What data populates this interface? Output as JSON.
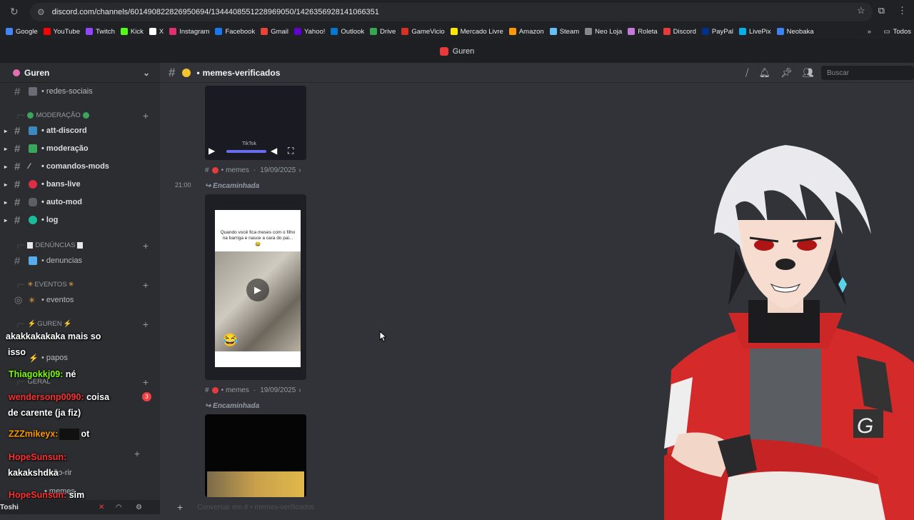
{
  "browser": {
    "url": "discord.com/channels/601490822826950694/1344408551228969050/1426356928141066351",
    "bookmarks": [
      {
        "label": "Google",
        "color": "#4285f4"
      },
      {
        "label": "YouTube",
        "color": "#ff0000"
      },
      {
        "label": "Twitch",
        "color": "#9146ff"
      },
      {
        "label": "Kick",
        "color": "#53fc18"
      },
      {
        "label": "X",
        "color": "#ffffff"
      },
      {
        "label": "Instagram",
        "color": "#e1306c"
      },
      {
        "label": "Facebook",
        "color": "#1877f2"
      },
      {
        "label": "Gmail",
        "color": "#ea4335"
      },
      {
        "label": "Yahoo!",
        "color": "#6001d2"
      },
      {
        "label": "Outlook",
        "color": "#0078d4"
      },
      {
        "label": "Drive",
        "color": "#34a853"
      },
      {
        "label": "GameVicio",
        "color": "#d93025"
      },
      {
        "label": "Mercado Livre",
        "color": "#ffe600"
      },
      {
        "label": "Amazon",
        "color": "#ff9900"
      },
      {
        "label": "Steam",
        "color": "#66c0f4"
      },
      {
        "label": "Neo Loja",
        "color": "#888888"
      },
      {
        "label": "Roleta",
        "color": "#c678dd"
      },
      {
        "label": "Discord",
        "color": "#e83a3a"
      },
      {
        "label": "PayPal",
        "color": "#003087"
      },
      {
        "label": "LivePix",
        "color": "#00b1ea"
      },
      {
        "label": "Neobaka",
        "color": "#3b82f6"
      }
    ],
    "all_bookmarks_label": "Todos"
  },
  "app": {
    "title": "Guren"
  },
  "sidebar": {
    "guild_name": "Guren",
    "channels": {
      "redes_sociais": "• redes-sociais",
      "att_discord": "• att-discord",
      "moderacao": "• moderação",
      "comandos_mods": "• comandos-mods",
      "bans_live": "• bans-live",
      "auto_mod": "• auto-mod",
      "log": "• log",
      "denuncias": "• denuncias",
      "eventos": "• eventos",
      "papos": "• papos",
      "nao_rir": "• não-rir",
      "memes": "• memes"
    },
    "categories": {
      "moderacao": "MODERAÇÃO",
      "denuncias": "DENÚNCIAS",
      "eventos": "EVENTOS",
      "guren": "GUREN",
      "geral": "GERAL"
    },
    "badge": "3",
    "user": "Toshi"
  },
  "overlay_chat": [
    {
      "user": "",
      "text": "akakkakakaka mais so",
      "color": "#ffffff"
    },
    {
      "user": "",
      "text": "isso",
      "color": "#ffffff"
    },
    {
      "user": "Thiagokkj09:",
      "text": "né",
      "color": "#7cfc00"
    },
    {
      "user": "wendersonp0090:",
      "text": "coisa",
      "color": "#ff3030"
    },
    {
      "user": "",
      "text": "de carente (ja fiz)",
      "color": "#ffffff"
    },
    {
      "user": "ZZZmikeyx:",
      "text": "ot",
      "color": "#ff9900"
    },
    {
      "user": "HopeSunsun:",
      "text": "",
      "color": "#ff3030"
    },
    {
      "user": "",
      "text": "kakakshdka",
      "color": "#ffffff"
    },
    {
      "user": "HopeSunsun:",
      "text": "sim",
      "color": "#ff3030"
    }
  ],
  "channel": {
    "name": "memes-verificados",
    "search_placeholder": "Buscar",
    "composer_placeholder": "Conversar em # • memes-verificados"
  },
  "messages": [
    {
      "source": "memes",
      "date": "19/09/2025",
      "forwarded": "Encaminhada",
      "time": "21:00",
      "caption": "Quando você fica meses com o filho na barriga e nasce a cara do pai... 😂"
    },
    {
      "source": "memes",
      "date": "19/09/2025",
      "forwarded": "Encaminhada"
    }
  ],
  "video": {
    "watermark": "TikTok"
  },
  "streamer_logo": "G"
}
